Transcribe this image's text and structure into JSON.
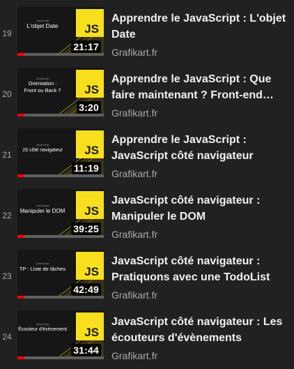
{
  "colors": {
    "background": "#212121",
    "title": "#f1f1f1",
    "meta": "#aaaaaa",
    "js_badge": "#f7df1e",
    "progress_watched": "#ff0000"
  },
  "playlist": {
    "items": [
      {
        "index": "19",
        "title": "Apprendre le JavaScript : L'objet Date",
        "channel": "Grafikart.fr",
        "duration": "21:17",
        "thumb_caption": "L'objet Date",
        "thumb_sub": "JavaScript",
        "thumb_badge": "JS",
        "watched_fraction": 0.08
      },
      {
        "index": "20",
        "title": "Apprendre le JavaScript : Que faire maintenant ? Front-end…",
        "channel": "Grafikart.fr",
        "duration": "3:20",
        "thumb_caption": "Orientation :\nFront ou Back ?",
        "thumb_sub": "JavaScript",
        "thumb_badge": "JS",
        "watched_fraction": 0.08
      },
      {
        "index": "21",
        "title": "Apprendre le JavaScript : JavaScript côté navigateur",
        "channel": "Grafikart.fr",
        "duration": "11:19",
        "thumb_caption": "JS côté navigateur",
        "thumb_sub": "JavaScript",
        "thumb_badge": "JS",
        "watched_fraction": 0.08
      },
      {
        "index": "22",
        "title": "JavaScript côté navigateur : Manipuler le DOM",
        "channel": "Grafikart.fr",
        "duration": "39:25",
        "thumb_caption": "Manipuler le DOM",
        "thumb_sub": "JavaScript",
        "thumb_badge": "JS",
        "watched_fraction": 0.08
      },
      {
        "index": "23",
        "title": "JavaScript côté navigateur : Pratiquons avec une TodoList",
        "channel": "Grafikart.fr",
        "duration": "42:49",
        "thumb_caption": "TP : Liste de tâches",
        "thumb_sub": "JavaScript",
        "thumb_badge": "JS",
        "watched_fraction": 0.08
      },
      {
        "index": "24",
        "title": "JavaScript côté navigateur : Les écouteurs d'évènements",
        "channel": "Grafikart.fr",
        "duration": "31:44",
        "thumb_caption": "Écouteur d'évènement",
        "thumb_sub": "JavaScript",
        "thumb_badge": "JS",
        "watched_fraction": 0.08
      }
    ]
  }
}
